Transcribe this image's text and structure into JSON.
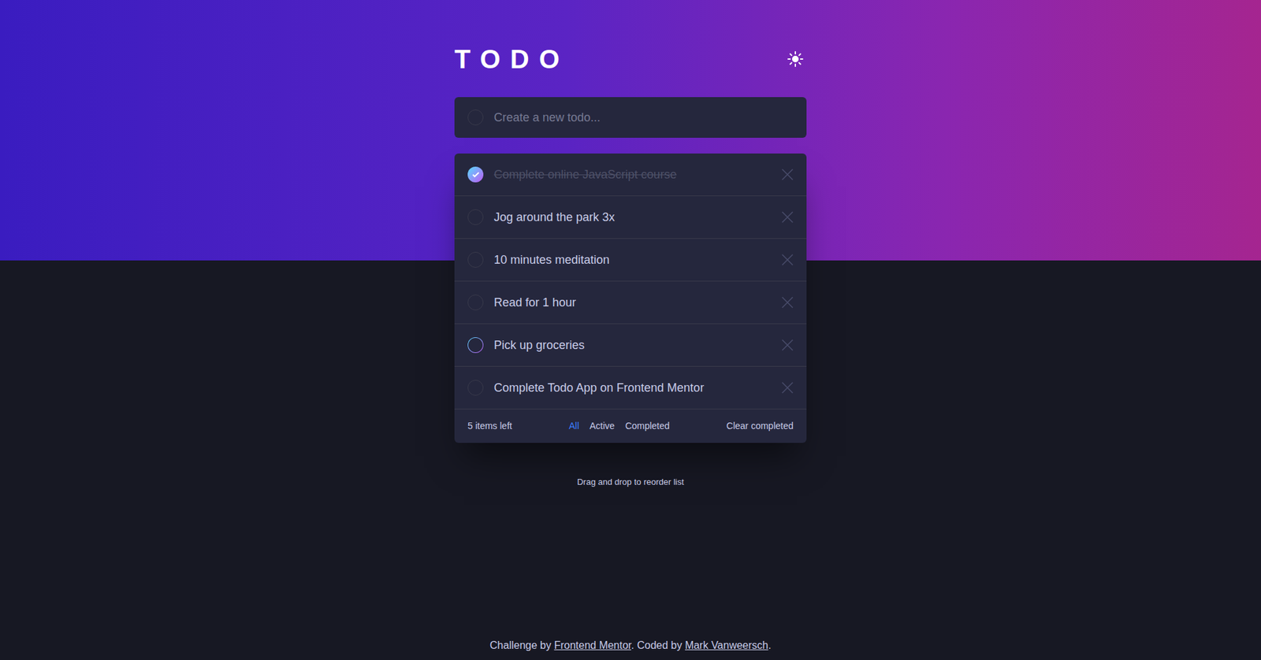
{
  "title": "TODO",
  "theme_toggle": {
    "mode": "dark"
  },
  "input": {
    "placeholder": "Create a new todo..."
  },
  "todos": [
    {
      "text": "Complete online JavaScript course",
      "completed": true,
      "hovered": false
    },
    {
      "text": "Jog around the park 3x",
      "completed": false,
      "hovered": false
    },
    {
      "text": "10 minutes meditation",
      "completed": false,
      "hovered": false
    },
    {
      "text": "Read for 1 hour",
      "completed": false,
      "hovered": false
    },
    {
      "text": "Pick up groceries",
      "completed": false,
      "hovered": true
    },
    {
      "text": "Complete Todo App on Frontend Mentor",
      "completed": false,
      "hovered": false
    }
  ],
  "list_footer": {
    "items_left": "5 items left",
    "filters": [
      {
        "label": "All",
        "selected": true
      },
      {
        "label": "Active",
        "selected": false
      },
      {
        "label": "Completed",
        "selected": false
      }
    ],
    "clear": "Clear completed"
  },
  "hint": "Drag and drop to reorder list",
  "credit": [
    {
      "text": "Challenge by ",
      "link": false
    },
    {
      "text": "Frontend Mentor",
      "link": true
    },
    {
      "text": ". Coded by ",
      "link": false
    },
    {
      "text": "Mark Vanweersch",
      "link": true
    },
    {
      "text": ".",
      "link": false
    }
  ]
}
